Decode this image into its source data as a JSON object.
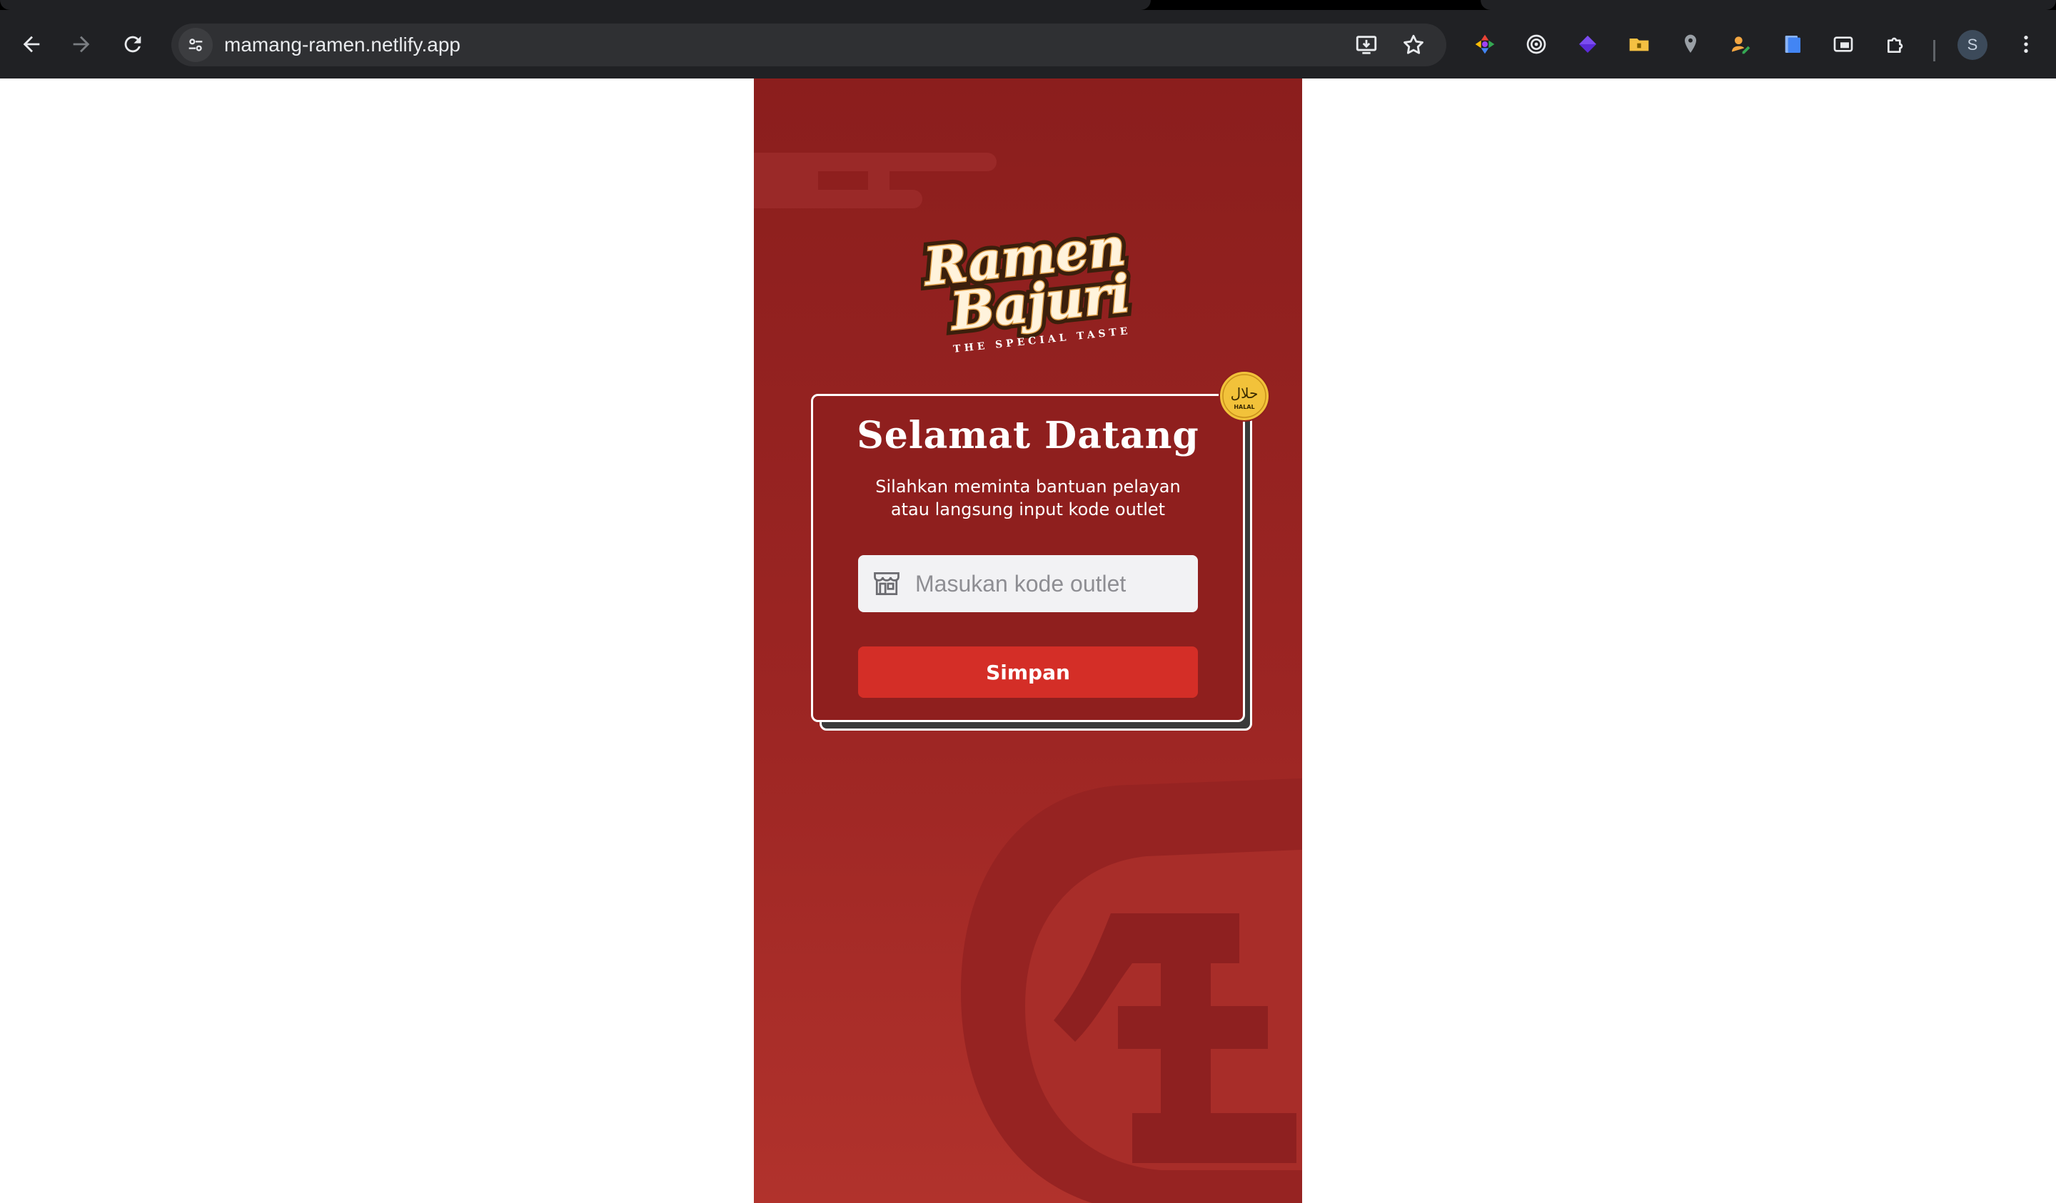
{
  "browser": {
    "url": "mamang-ramen.netlify.app",
    "profile_initial": "S",
    "extensions": [
      "colorpicker-icon",
      "target-icon",
      "diamond-icon",
      "folder-icon",
      "map-pin-icon",
      "person-pen-icon",
      "document-icon",
      "window-icon",
      "puzzle-icon"
    ]
  },
  "app": {
    "logo": {
      "line1": "Ramen",
      "line2": "Bajuri",
      "tagline": "THE SPECIAL TASTE"
    },
    "halal_badge": {
      "arabic": "حلال",
      "latin": "HALAL"
    },
    "welcome_title": "Selamat Datang",
    "subtitle_line1": "Silahkan meminta bantuan pelayan",
    "subtitle_line2": "atau langsung input kode outlet",
    "outlet_input": {
      "placeholder": "Masukan kode outlet",
      "value": ""
    },
    "submit_label": "Simpan",
    "colors": {
      "background": "#9c2523",
      "card": "#8f1f1e",
      "button": "#d42e27",
      "badge": "#f2c23a"
    }
  }
}
